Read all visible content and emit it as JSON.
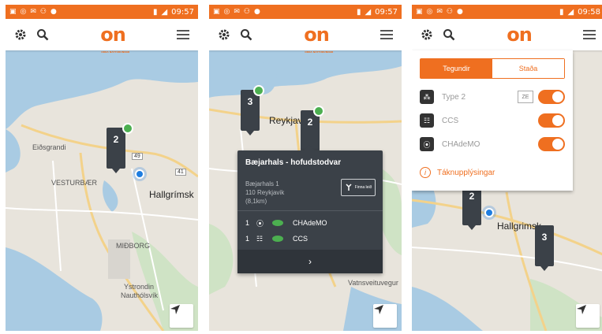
{
  "status": {
    "screen1_time": "09:57",
    "screen2_time": "09:57",
    "screen3_time": "09:58"
  },
  "app": {
    "logo": "on",
    "logo_tagline": "ORKA NÁTTÚRUNNAR"
  },
  "icons": {
    "settings": "gear-icon",
    "search": "search-icon",
    "menu": "hamburger-menu-icon",
    "navigate": "navigation-arrow-icon",
    "directions": "directions-icon"
  },
  "map": {
    "labels": {
      "eidsgrandi": "Eiðsgrandi",
      "vesturbaer": "VESTURBÆR",
      "hallgrimskirkja": "Hallgrímsk",
      "hallgrimskirkja3": "Hallgrimsk",
      "midborg": "MIÐBORG",
      "ystrondin": "Ystrondin",
      "nautholsvik": "Nauthólsvík",
      "reykjavik": "Reykjavík",
      "vatnsveituvegur": "Vatnsveituvegur",
      "road41": "41",
      "road49": "49"
    },
    "clusters": {
      "screen1": "2",
      "screen2_a": "3",
      "screen2_b": "2",
      "screen3_a": "2",
      "screen3_b": "3"
    }
  },
  "popup": {
    "title": "Bæjarhals - hofudstodvar",
    "address_line1": "Bæjarhals 1",
    "address_line2": "110 Reykjavik",
    "distance": "(8,1km)",
    "directions_label": "Finna leið",
    "connectors": [
      {
        "count": "1",
        "type": "CHAdeMO"
      },
      {
        "count": "1",
        "type": "CCS"
      }
    ],
    "more": "›"
  },
  "filter": {
    "tabs": {
      "active": "Tegundir",
      "inactive": "Staða"
    },
    "plugs": [
      {
        "label": "Type 2",
        "badge": "ZE"
      },
      {
        "label": "CCS"
      },
      {
        "label": "CHAdeMO"
      }
    ],
    "info_link": "Táknupplýsingar"
  },
  "colors": {
    "brand_orange": "#ef6f20",
    "cluster_dark": "#3b4148",
    "available_green": "#4caf50",
    "location_blue": "#1e7de0",
    "water": "#a9cbe3",
    "land": "#e8e4dc"
  }
}
